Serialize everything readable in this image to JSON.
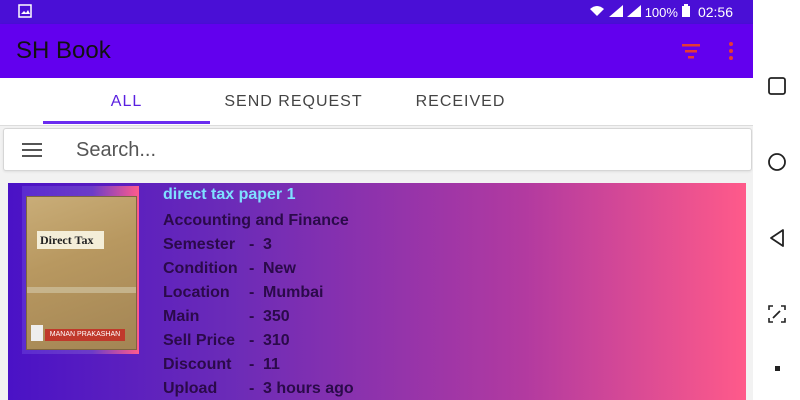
{
  "status": {
    "battery": "100%",
    "time": "02:56"
  },
  "app": {
    "title": "SH Book"
  },
  "tabs": [
    {
      "label": "ALL"
    },
    {
      "label": "SEND REQUEST"
    },
    {
      "label": "RECEIVED"
    }
  ],
  "search": {
    "placeholder": "Search..."
  },
  "book": {
    "title": "direct tax paper 1",
    "subject": "Accounting and Finance",
    "cover_title": "Direct Tax",
    "cover_publisher": "MANAN PRAKASHAN",
    "fields": [
      {
        "label": "Semester",
        "value": "3"
      },
      {
        "label": "Condition",
        "value": "New"
      },
      {
        "label": "Location",
        "value": "Mumbai"
      },
      {
        "label": "Main",
        "value": "350"
      },
      {
        "label": "Sell Price",
        "value": "310"
      },
      {
        "label": "Discount",
        "value": "11"
      },
      {
        "label": "Upload",
        "value": "3 hours ago"
      }
    ]
  },
  "colors": {
    "statusbar": "#4a0fd6",
    "appbar": "#6200ee",
    "accent": "#6a2cf0",
    "card_start": "#4a12c6",
    "card_end": "#ff5a8a"
  }
}
